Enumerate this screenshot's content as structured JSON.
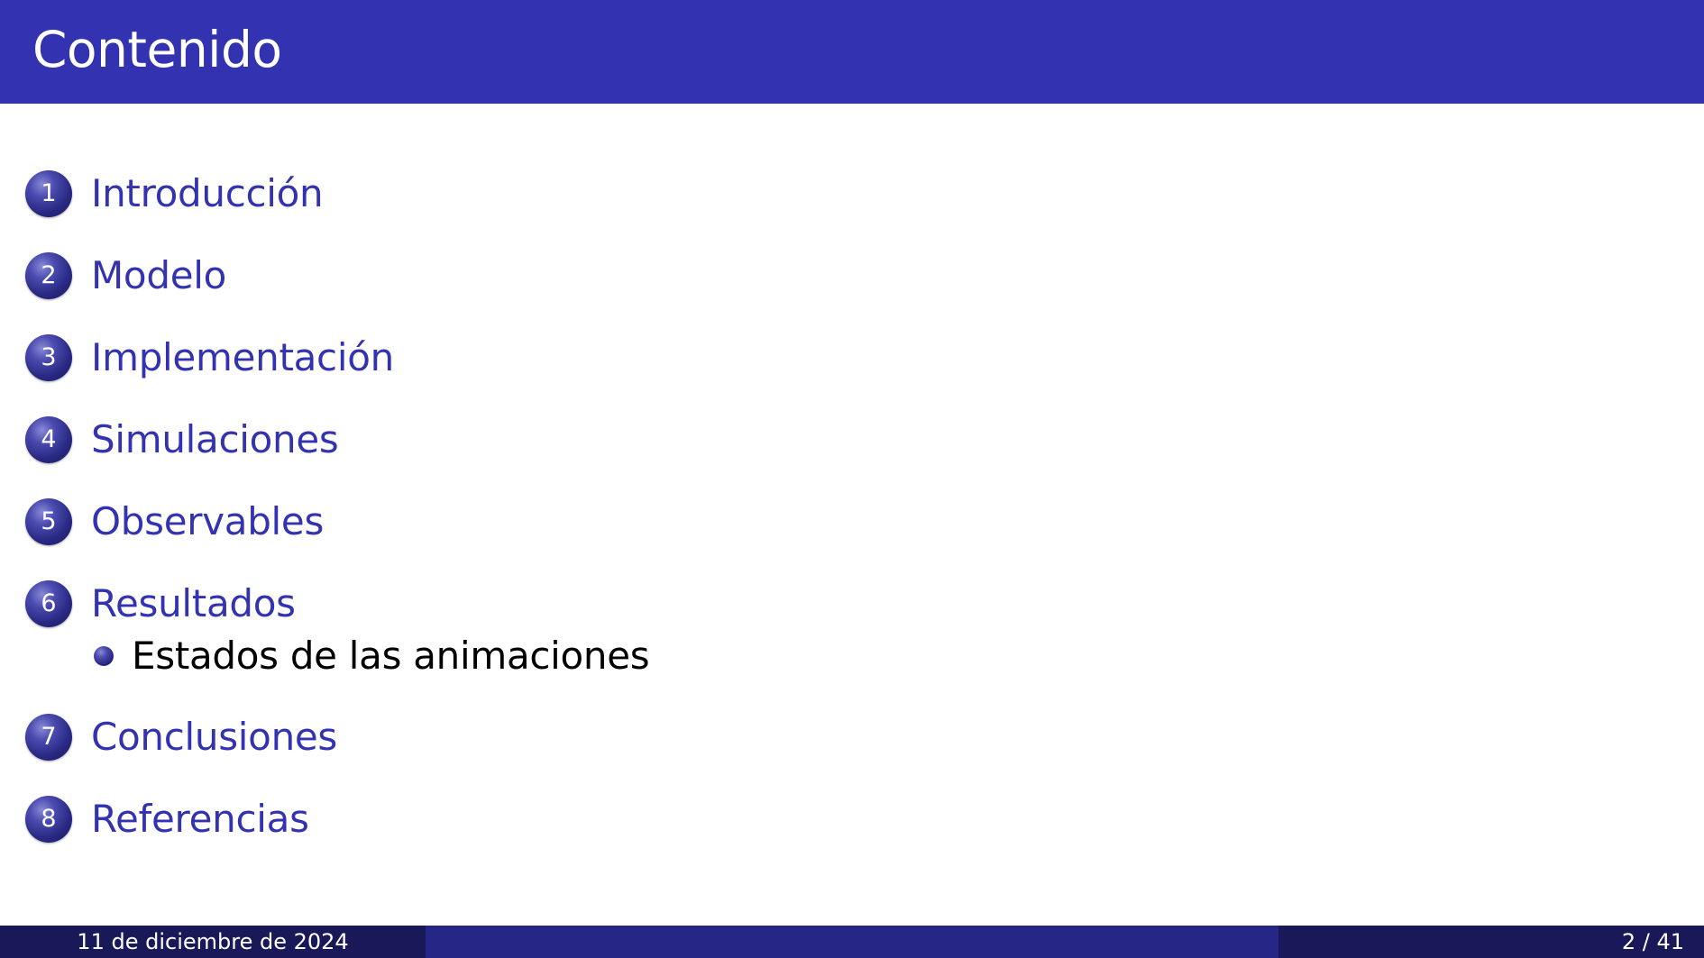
{
  "header": {
    "title": "Contenido"
  },
  "toc": {
    "sections": [
      {
        "number": "1",
        "label": "Introducción"
      },
      {
        "number": "2",
        "label": "Modelo"
      },
      {
        "number": "3",
        "label": "Implementación"
      },
      {
        "number": "4",
        "label": "Simulaciones"
      },
      {
        "number": "5",
        "label": "Observables"
      },
      {
        "number": "6",
        "label": "Resultados",
        "subsections": [
          {
            "label": "Estados de las animaciones"
          }
        ]
      },
      {
        "number": "7",
        "label": "Conclusiones"
      },
      {
        "number": "8",
        "label": "Referencias"
      }
    ]
  },
  "footer": {
    "date": "11 de diciembre de 2024",
    "page": "2 / 41"
  },
  "colors": {
    "header_bg": "#3333b2",
    "section_text": "#3333b2",
    "footer_dark": "#191959",
    "footer_mid": "#262686"
  }
}
